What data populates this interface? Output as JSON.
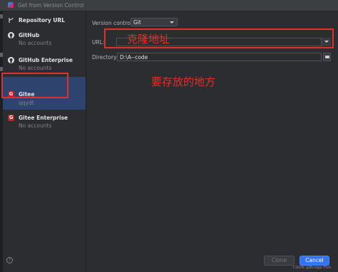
{
  "window": {
    "title": "Get from Version Control"
  },
  "sidebar": {
    "items": [
      {
        "label": "Repository URL",
        "sub": ""
      },
      {
        "label": "GitHub",
        "sub": "No accounts"
      },
      {
        "label": "GitHub Enterprise",
        "sub": "No accounts"
      },
      {
        "label": "Gitee",
        "sub": "qqydt"
      },
      {
        "label": "Gitee Enterprise",
        "sub": "No accounts"
      }
    ],
    "gitee_logo": "G"
  },
  "form": {
    "version_control_label": "Version control:",
    "version_control_value": "Git",
    "url_label": "URL:",
    "url_value": "",
    "directory_label": "Directory:",
    "directory_value": "D:\\A--code"
  },
  "annotations": {
    "url_note": "克隆地址",
    "directory_note": "要存放的地方"
  },
  "buttons": {
    "clone": "Clone",
    "cancel": "Cancel",
    "help": "?"
  },
  "watermark": "CSDN @Bridge Fish",
  "colors": {
    "accent": "#3574f0",
    "annotation": "#e0302a",
    "gitee": "#c71d23",
    "selected": "#2e436e"
  }
}
